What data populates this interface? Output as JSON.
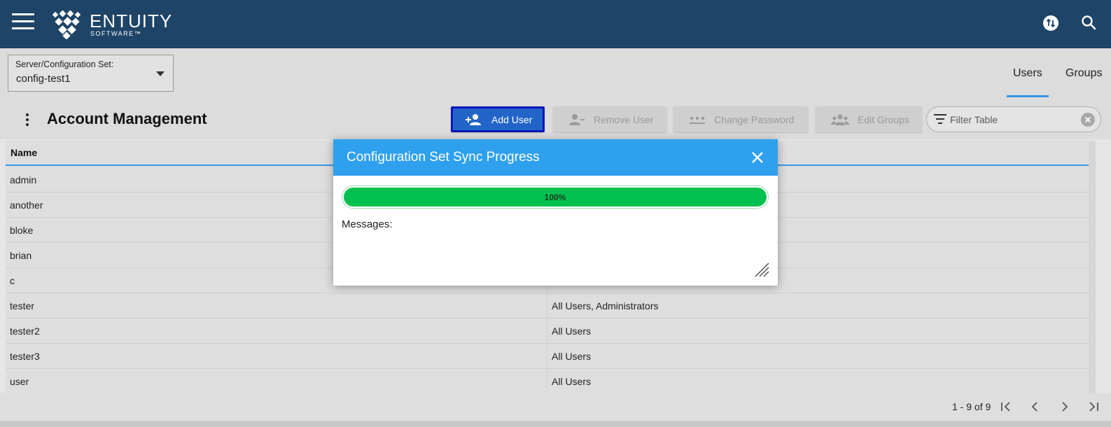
{
  "header": {
    "brand_name": "ENTUITY",
    "brand_sub": "SOFTWARE™"
  },
  "config": {
    "label": "Server/Configuration Set:",
    "value": "config-test1"
  },
  "tabs": [
    {
      "label": "Users",
      "active": true
    },
    {
      "label": "Groups",
      "active": false
    }
  ],
  "toolbar": {
    "title": "Account Management",
    "add_user": "Add User",
    "remove_user": "Remove User",
    "change_password": "Change Password",
    "edit_groups": "Edit Groups",
    "filter_placeholder": "Filter Table"
  },
  "table": {
    "columns": [
      "Name",
      ""
    ],
    "rows": [
      {
        "name": "admin",
        "groups": ""
      },
      {
        "name": "another",
        "groups": ""
      },
      {
        "name": "bloke",
        "groups": ""
      },
      {
        "name": "brian",
        "groups": ""
      },
      {
        "name": "c",
        "groups": ""
      },
      {
        "name": "tester",
        "groups": "All Users, Administrators"
      },
      {
        "name": "tester2",
        "groups": "All Users"
      },
      {
        "name": "tester3",
        "groups": "All Users"
      },
      {
        "name": "user",
        "groups": "All Users"
      }
    ]
  },
  "pager": {
    "text": "1 - 9 of 9"
  },
  "dialog": {
    "title": "Configuration Set Sync Progress",
    "progress_value": 100,
    "progress_label": "100%",
    "messages_label": "Messages:"
  },
  "colors": {
    "topbar": "#1e4468",
    "accent": "#3a96e8",
    "dialog_header": "#2fa0ee",
    "progress": "#00c050",
    "add_button": "#2264c8"
  }
}
